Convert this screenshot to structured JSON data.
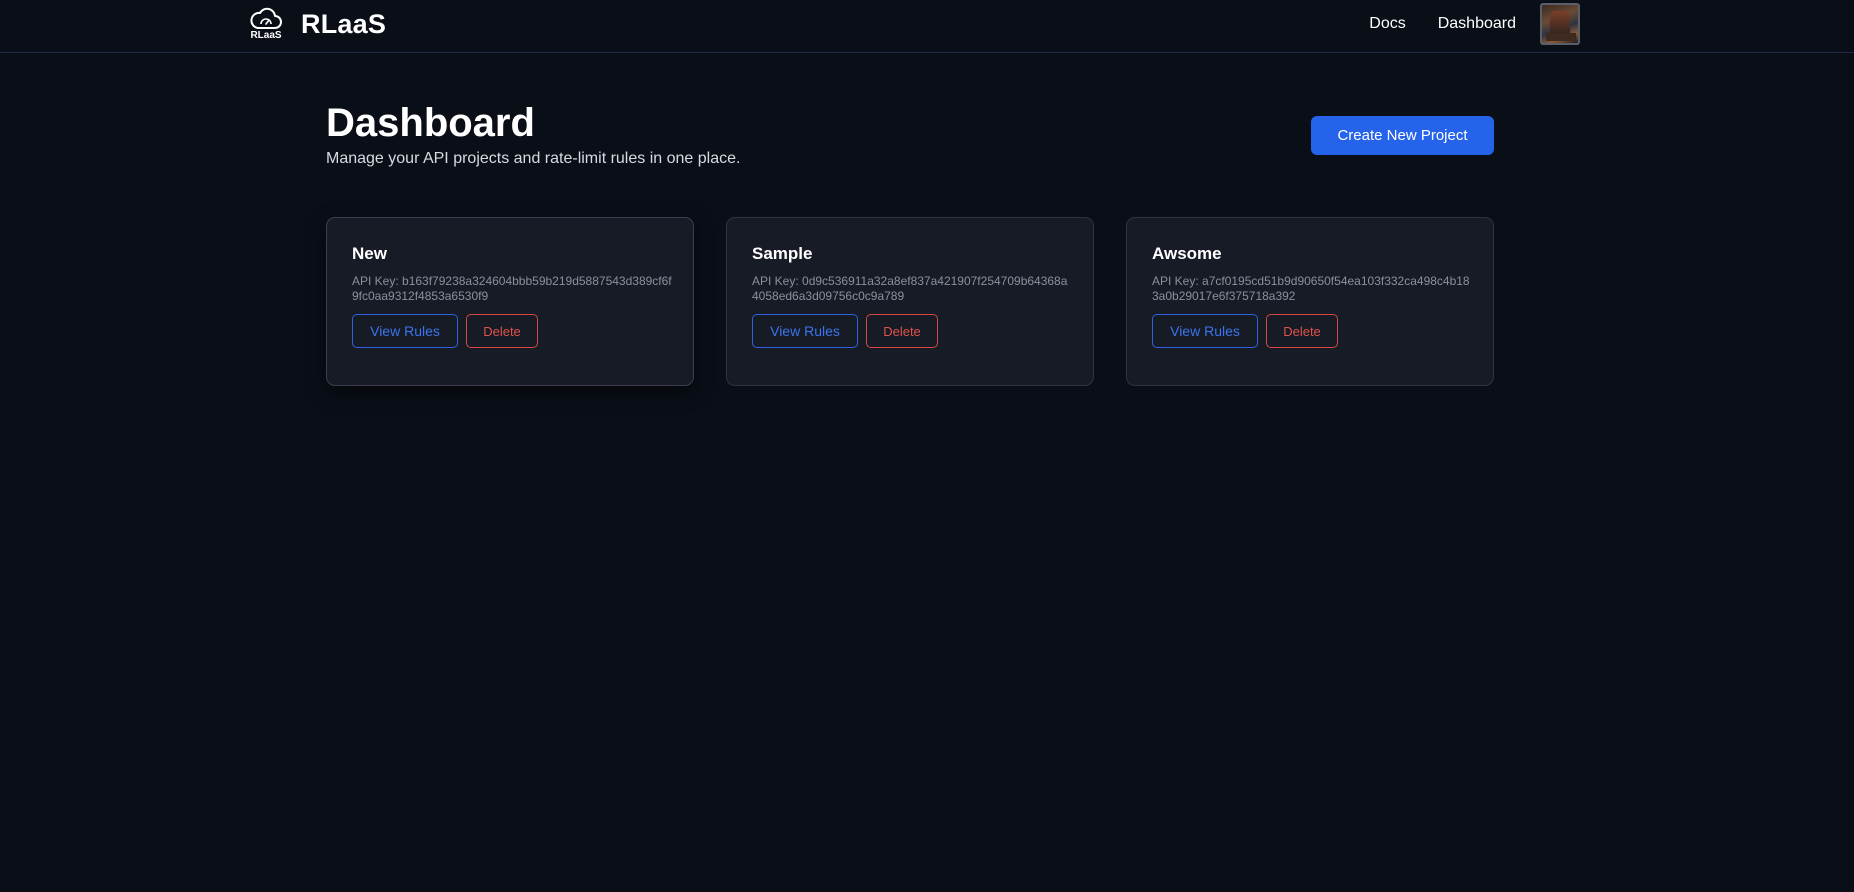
{
  "navbar": {
    "logo_text": "RLaaS",
    "brand": "RLaaS",
    "links": [
      "Docs",
      "Dashboard"
    ]
  },
  "header": {
    "title": "Dashboard",
    "subtitle": "Manage your API projects and rate-limit rules in one place.",
    "create_label": "Create New Project"
  },
  "projects": [
    {
      "name": "New",
      "api_key": "API Key: b163f79238a324604bbb59b219d5887543d389cf6f9fc0aa9312f4853a6530f9",
      "view_label": "View Rules",
      "delete_label": "Delete"
    },
    {
      "name": "Sample",
      "api_key": "API Key: 0d9c536911a32a8ef837a421907f254709b64368a4058ed6a3d09756c0c9a789",
      "view_label": "View Rules",
      "delete_label": "Delete"
    },
    {
      "name": "Awsome",
      "api_key": "API Key: a7cf0195cd51b9d90650f54ea103f332ca498c4b183a0b29017e6f375718a392",
      "view_label": "View Rules",
      "delete_label": "Delete"
    }
  ],
  "colors": {
    "background": "#0a0e17",
    "card": "#161b26",
    "primary": "#2563eb",
    "danger": "#e0524a"
  },
  "icons": {
    "logo": "cloud-gauge-icon",
    "avatar": "user-avatar"
  }
}
